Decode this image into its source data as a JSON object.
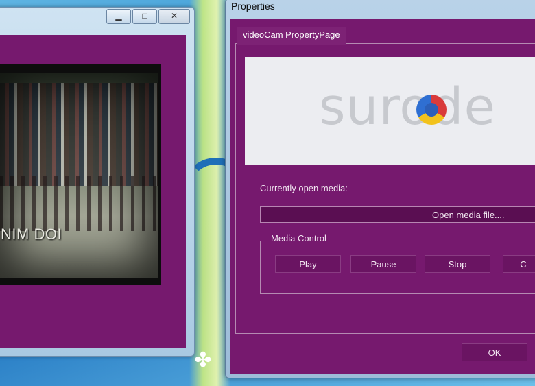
{
  "desktop": {
    "gadget_icon": "flower-icon"
  },
  "left_window": {
    "minimize_icon": "minimize-icon",
    "maximize_icon": "maximize-icon",
    "close_icon": "close-icon",
    "video_overlay_text": "NIM DOI"
  },
  "properties": {
    "title": "Properties",
    "tab_label": "videoCam PropertyPage",
    "logo_text": "surode",
    "current_media_label": "Currently open media:",
    "open_media_button": "Open media file....",
    "media_control_legend": "Media Control",
    "play_button": "Play",
    "pause_button": "Pause",
    "stop_button": "Stop",
    "fourth_button": "C",
    "ok_button": "OK"
  },
  "colors": {
    "dialog_bg": "#76196e",
    "window_frame": "#a9c9e2"
  }
}
